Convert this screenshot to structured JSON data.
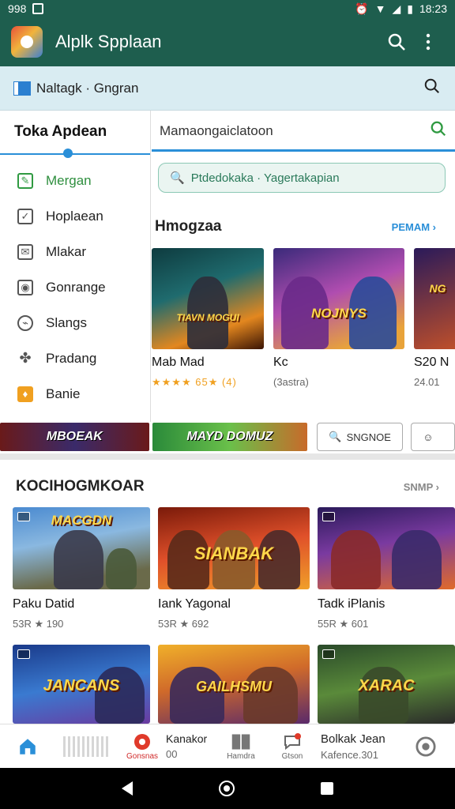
{
  "status": {
    "time_left": "998",
    "time_right": "18:23"
  },
  "appbar": {
    "title": "Alplk Spplaan"
  },
  "subbar": {
    "label": "Naltagk · Gngran"
  },
  "sidebar": {
    "header": "Toka Apdean",
    "items": [
      {
        "label": "Mergan",
        "icon": "leaf-icon"
      },
      {
        "label": "Hoplaean",
        "icon": "checkbox-icon"
      },
      {
        "label": "Mlakar",
        "icon": "mail-icon"
      },
      {
        "label": "Gonrange",
        "icon": "camera-icon"
      },
      {
        "label": "Slangs",
        "icon": "tag-icon"
      },
      {
        "label": "Pradang",
        "icon": "puzzle-icon"
      },
      {
        "label": "Banie",
        "icon": "gift-icon"
      }
    ]
  },
  "search": {
    "value": "Mamaongaiclatoon"
  },
  "pill": {
    "label": "Ptdedokaka · Yagertakapian"
  },
  "section1": {
    "title": "Hmogzaa",
    "more": "PEMAM ›",
    "cards": [
      {
        "title": "Mab Mad",
        "sub": "★★★★ 65★ (4)",
        "art": "TIAVN MOGUI"
      },
      {
        "title": "Kc",
        "sub": "(3astra)",
        "art": "NOJNYS"
      },
      {
        "title": "S20 N",
        "sub": "24.01",
        "art": "NG"
      }
    ]
  },
  "strip": {
    "banner1": "MBOEAK",
    "banner2": "MAYD DOMUZ",
    "button": "SNGNOE"
  },
  "section2": {
    "title": "KOCIHOGMKOAR",
    "more": "SNMP ›",
    "cards": [
      {
        "title": "Paku Datid",
        "sub": "53R ★ 190",
        "art": "MACGDN"
      },
      {
        "title": "Iank Yagonal",
        "sub": "53R ★ 692",
        "art": "SIANBAK"
      },
      {
        "title": "Tadk iPlanis",
        "sub": "55R ★ 601",
        "art": ""
      }
    ],
    "row3": [
      {
        "art": "JANCANS"
      },
      {
        "art": "GAILHSMU"
      },
      {
        "art": "XARAC"
      }
    ]
  },
  "bottom": {
    "item2": "Gonsnas",
    "item3_title": "Kanakor",
    "item3_sub": "00",
    "item4": "Hamdra",
    "item5": "Gtson",
    "item6_title": "Bolkak Jean",
    "item6_sub": "Kafence.301"
  }
}
